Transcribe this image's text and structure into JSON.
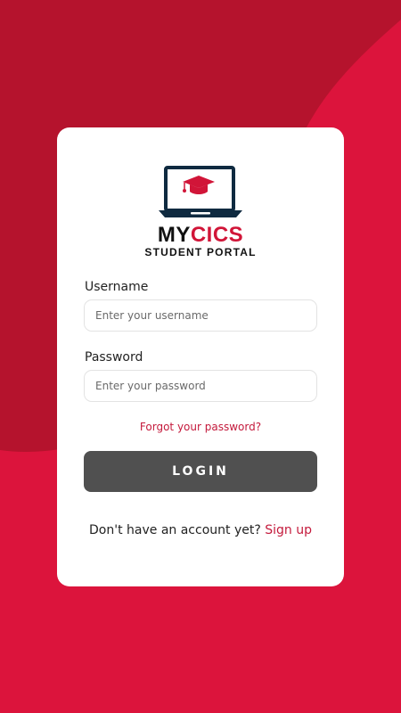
{
  "colors": {
    "background": "#dc143c",
    "background_dark": "#b5132d",
    "card": "#ffffff",
    "accent": "#d11538",
    "button": "#505050"
  },
  "logo": {
    "icon": "laptop-graduation-cap-icon",
    "brand_part1": "MY",
    "brand_part2": "CICS",
    "tagline": "STUDENT PORTAL"
  },
  "form": {
    "username_label": "Username",
    "username_placeholder": "Enter your username",
    "username_value": "",
    "password_label": "Password",
    "password_placeholder": "Enter your password",
    "password_value": "",
    "forgot_link": "Forgot your password?",
    "login_button": "LOGIN"
  },
  "signup": {
    "prompt": "Don't have an account yet?",
    "link": "Sign up"
  }
}
